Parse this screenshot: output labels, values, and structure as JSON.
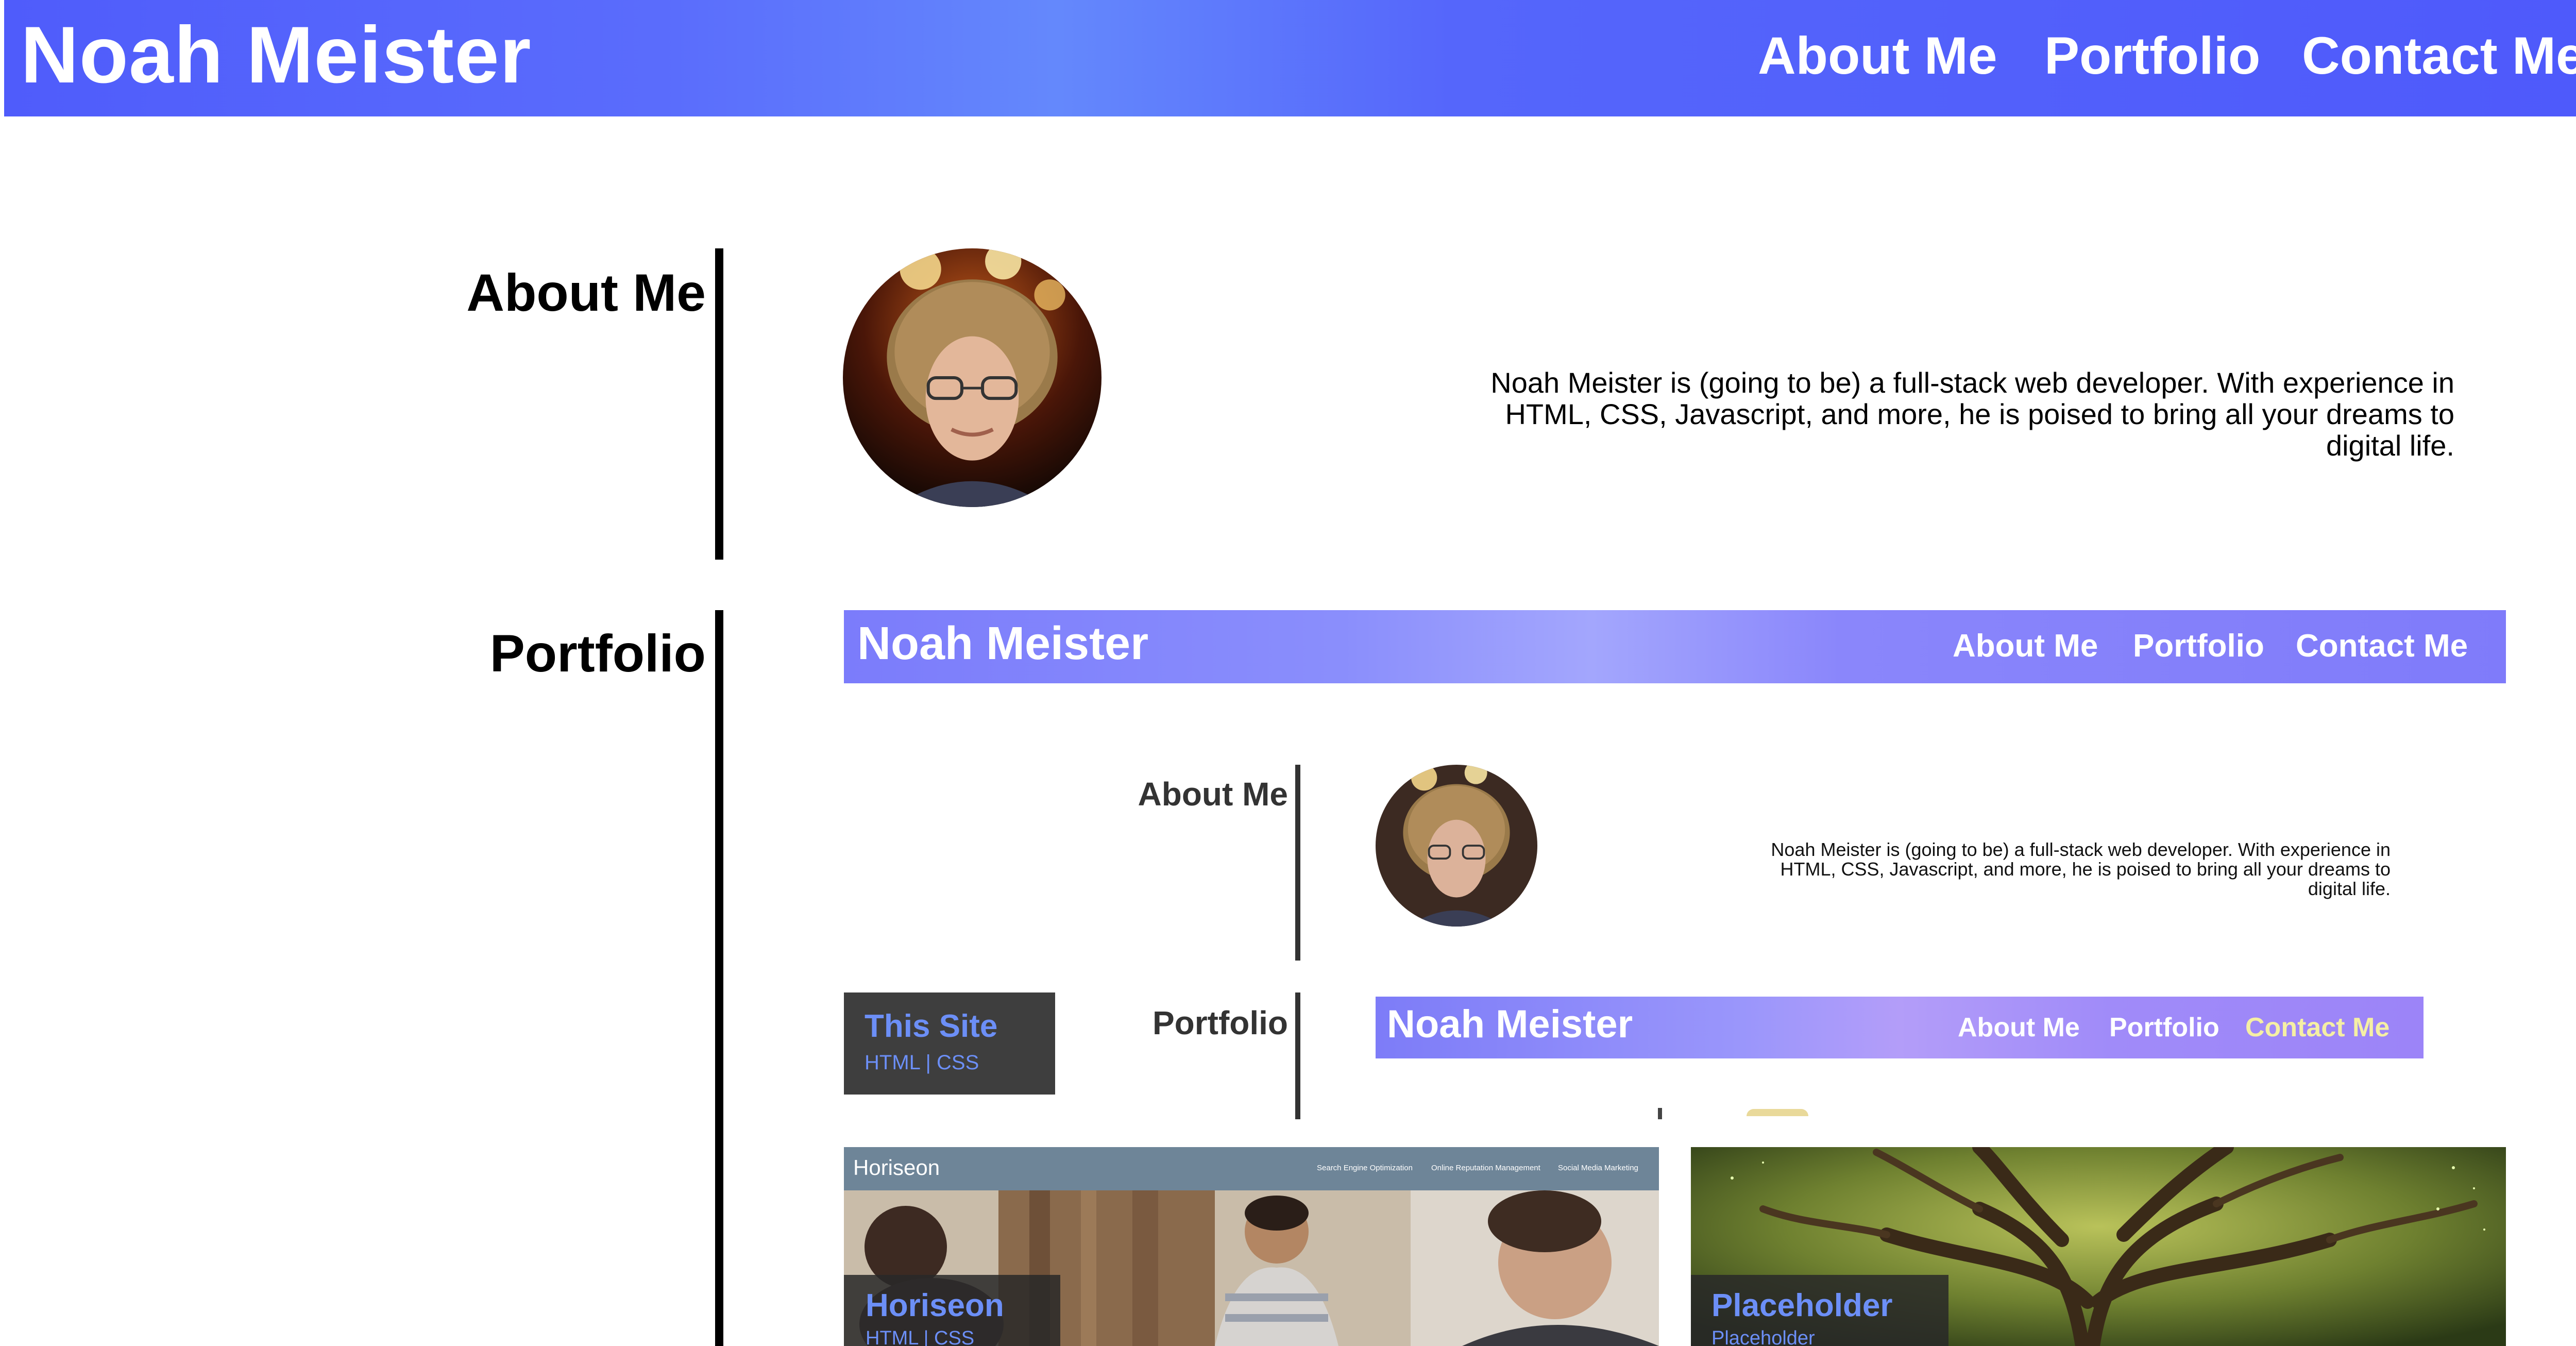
{
  "header": {
    "brand": "Noah Meister",
    "nav": [
      "About Me",
      "Portfolio",
      "Contact Me"
    ]
  },
  "about": {
    "title": "About Me",
    "text": "Noah Meister is (going to be) a full-stack web developer. With experience in HTML, CSS, Javascript, and more, he is poised to bring all your dreams to digital life."
  },
  "portfolio": {
    "title": "Portfolio",
    "preview": {
      "brand": "Noah Meister",
      "nav": [
        "About Me",
        "Portfolio",
        "Contact Me"
      ],
      "about_title": "About Me",
      "about_text": "Noah Meister is (going to be) a full-stack web developer. With experience in HTML, CSS, Javascript, and more, he is poised to bring all your dreams to digital life.",
      "portfolio_title": "Portfolio",
      "nested_brand": "Noah Meister",
      "nested_nav": [
        "About Me",
        "Portfolio",
        "Contact Me"
      ]
    },
    "projects": [
      {
        "title": "This Site",
        "tags": "HTML | CSS"
      },
      {
        "title": "Horiseon",
        "tags": "HTML | CSS",
        "screenshot": {
          "logo": "Horiseon",
          "nav": [
            "Search Engine Optimization",
            "Online Reputation Management",
            "Social Media Marketing"
          ]
        }
      },
      {
        "title": "Placeholder",
        "tags": "Placeholder"
      }
    ]
  },
  "colors": {
    "header_blue": "#4f5cfb",
    "card_label": "#6c8ff7",
    "active_nav_highlight": "#f5efa4"
  }
}
